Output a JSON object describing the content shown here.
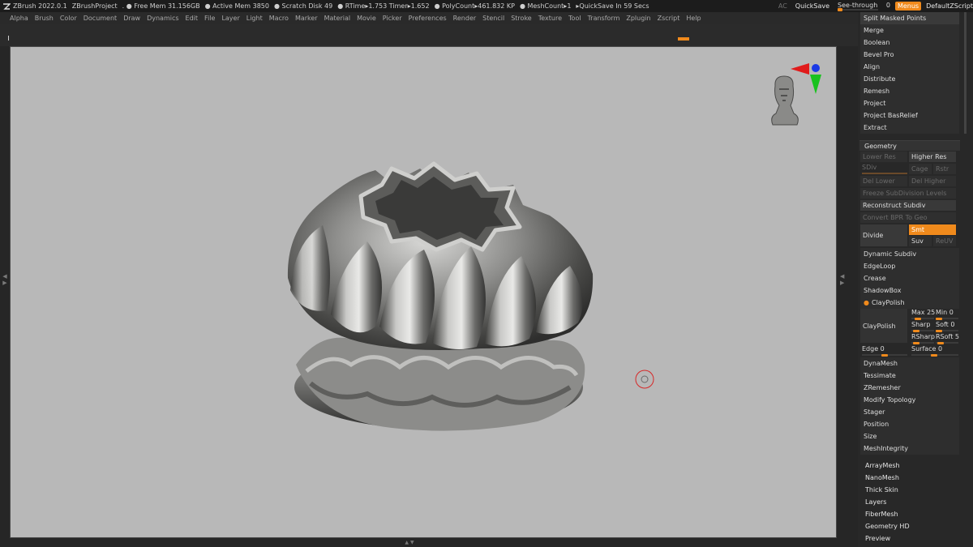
{
  "titlebar": {
    "app": "ZBrush 2022.0.1",
    "project": "ZBrushProject",
    "free_mem": ". ● Free Mem 31.156GB",
    "active_mem": "● Active Mem 3850",
    "scratch": "● Scratch Disk 49",
    "rtime": "● RTime▸1.753 Timer▸1.652",
    "polycount": "● PolyCount▸461.832 KP",
    "meshcount": "● MeshCount▸1",
    "quicksave_timer": "▸QuickSave In 59 Secs",
    "ac": "AC",
    "quicksave": "QuickSave",
    "see_through": "See-through",
    "see_through_value": "0",
    "menus": "Menus",
    "default_zscript": "DefaultZScript"
  },
  "menubar": [
    "Alpha",
    "Brush",
    "Color",
    "Document",
    "Draw",
    "Dynamics",
    "Edit",
    "File",
    "Layer",
    "Light",
    "Macro",
    "Marker",
    "Material",
    "Movie",
    "Picker",
    "Preferences",
    "Render",
    "Stencil",
    "Stroke",
    "Texture",
    "Tool",
    "Transform",
    "Zplugin",
    "Zscript",
    "Help"
  ],
  "subtool_menu": [
    "Split Masked Points",
    "Merge",
    "Boolean",
    "Bevel Pro",
    "Align",
    "Distribute",
    "Remesh",
    "Project",
    "Project BasRelief",
    "Extract"
  ],
  "geometry": {
    "header": "Geometry",
    "lower_res": "Lower Res",
    "higher_res": "Higher Res",
    "sdiv": "SDiv",
    "cage": "Cage",
    "rstr": "Rstr",
    "del_lower": "Del Lower",
    "del_higher": "Del Higher",
    "freeze": "Freeze SubDivision Levels",
    "reconstruct": "Reconstruct Subdiv",
    "convert_bpr": "Convert BPR To Geo",
    "divide": "Divide",
    "smt": "Smt",
    "suv": "Suv",
    "reuv": "ReUV",
    "dynamic_subdiv": "Dynamic Subdiv",
    "edgeloop": "EdgeLoop",
    "crease": "Crease",
    "shadowbox": "ShadowBox",
    "claypolish_header": "ClayPolish",
    "claypolish_btn": "ClayPolish",
    "max_label": "Max 25",
    "min_label": "Min 0",
    "sharp_label": "Sharp",
    "soft_label": "Soft 0",
    "rsharp_label": "RSharp",
    "rsoft_label": "RSoft 5",
    "edge_label": "Edge 0",
    "surface_label": "Surface 0",
    "more": [
      "DynaMesh",
      "Tessimate",
      "ZRemesher",
      "Modify Topology",
      "Stager",
      "Position",
      "Size",
      "MeshIntegrity"
    ]
  },
  "tool_sections": [
    "ArrayMesh",
    "NanoMesh",
    "Thick Skin",
    "Layers",
    "FiberMesh",
    "Geometry HD",
    "Preview"
  ],
  "colors": {
    "accent": "#f08a1c",
    "canvas_bg": "#b8b8b8",
    "gizmo_x": "#e01b1b",
    "gizmo_y": "#19c21f",
    "gizmo_z": "#1a39e6"
  }
}
